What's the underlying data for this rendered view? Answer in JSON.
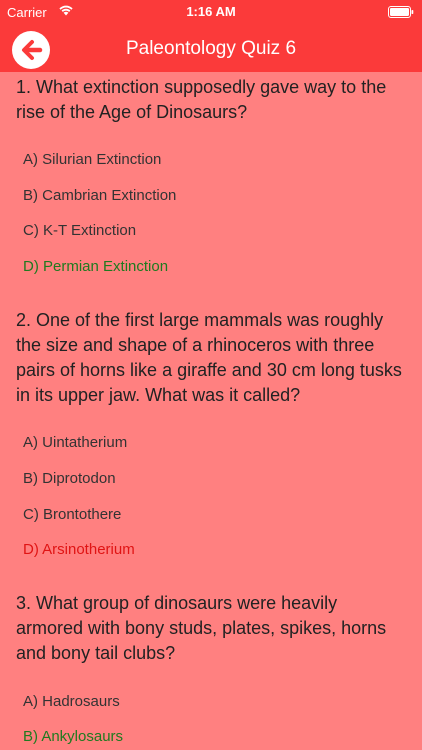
{
  "status_bar": {
    "carrier": "Carrier",
    "time": "1:16 AM"
  },
  "nav": {
    "title": "Paleontology Quiz 6",
    "back_icon": "back-arrow-icon"
  },
  "colors": {
    "bar": "#fb3a3a",
    "background": "#ff8080",
    "correct": "#1f7a1f",
    "wrong": "#e01414"
  },
  "questions": [
    {
      "text": "1. What extinction supposedly gave way to the rise of the Age of Dinosaurs?",
      "answers": [
        {
          "label": "A) Silurian Extinction",
          "state": "neutral"
        },
        {
          "label": "B) Cambrian Extinction",
          "state": "neutral"
        },
        {
          "label": "C) K-T Extinction",
          "state": "neutral"
        },
        {
          "label": "D) Permian Extinction",
          "state": "correct"
        }
      ]
    },
    {
      "text": "2. One of the first large mammals was roughly the size and shape of a rhinoceros with three pairs of horns like a giraffe and 30 cm long tusks in its upper jaw. What was it called?",
      "answers": [
        {
          "label": "A) Uintatherium",
          "state": "neutral"
        },
        {
          "label": "B) Diprotodon",
          "state": "neutral"
        },
        {
          "label": "C) Brontothere",
          "state": "neutral"
        },
        {
          "label": "D) Arsinotherium",
          "state": "wrong"
        }
      ]
    },
    {
      "text": "3. What group of dinosaurs were heavily armored with bony studs, plates, spikes, horns and bony tail clubs?",
      "answers": [
        {
          "label": "A) Hadrosaurs",
          "state": "neutral"
        },
        {
          "label": "B) Ankylosaurs",
          "state": "correct"
        }
      ]
    }
  ]
}
